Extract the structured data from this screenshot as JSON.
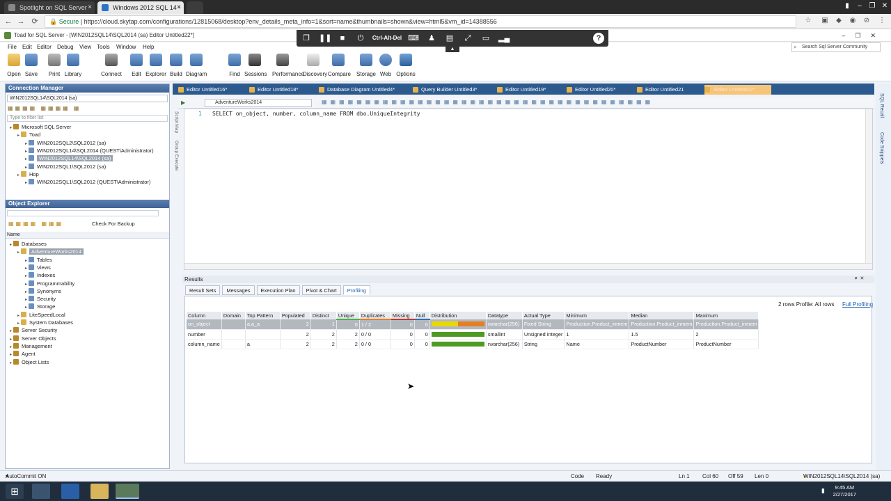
{
  "browser": {
    "tabs": [
      {
        "label": "Spotlight on SQL Server"
      },
      {
        "label": "Windows 2012 SQL 14 -"
      }
    ],
    "url_secure": "Secure",
    "url": "https://cloud.skytap.com/configurations/12815068/desktop?env_details_meta_info=1&sort=name&thumbnails=shown&view=html5&vm_id=14388556"
  },
  "remote_toolbar": {
    "ctrl_alt_del": "Ctrl-Alt-Del",
    "help": "?"
  },
  "toad": {
    "title": "Toad for SQL Server - [WIN2012SQL14\\SQL2014 (sa) Editor Untitled22*]",
    "menu": [
      "File",
      "Edit",
      "Editor",
      "Debug",
      "View",
      "Tools",
      "Window",
      "Help"
    ],
    "search_placeholder": "Search Sql Server Community",
    "ribbon": [
      "Open",
      "Save",
      "Print",
      "Library",
      "Connect",
      "Edit",
      "Explorer",
      "Build",
      "Diagram",
      "Find",
      "Sessions",
      "Performance",
      "Discovery",
      "Compare",
      "Storage",
      "Web",
      "Options"
    ]
  },
  "connection_manager": {
    "title": "Connection Manager",
    "selected_connection": "WIN2012SQL14\\SQL2014 (sa)",
    "filter_placeholder": "Type to filter list",
    "tree": [
      {
        "label": "Microsoft SQL Server",
        "level": 0
      },
      {
        "label": "Toad",
        "level": 1
      },
      {
        "label": "WIN2012SQL2\\SQL2012 (sa)",
        "level": 2
      },
      {
        "label": "WIN2012SQL14\\SQL2014 (QUEST\\Administrator)",
        "level": 2
      },
      {
        "label": "WIN2012SQL14\\SQL2014 (sa)",
        "level": 2,
        "selected": true
      },
      {
        "label": "WIN2012SQL1\\SQL2012 (sa)",
        "level": 2
      },
      {
        "label": "Hop",
        "level": 1
      },
      {
        "label": "WIN2012SQL1\\SQL2012 (QUEST\\Administrator)",
        "level": 2
      }
    ]
  },
  "object_explorer": {
    "title": "Object Explorer",
    "check_backup": "Check For Backup",
    "name_header": "Name",
    "tree": [
      {
        "label": "Databases",
        "level": 0
      },
      {
        "label": "AdventureWorks2014",
        "level": 1,
        "selected": true
      },
      {
        "label": "Tables",
        "level": 2
      },
      {
        "label": "Views",
        "level": 2
      },
      {
        "label": "Indexes",
        "level": 2
      },
      {
        "label": "Programmability",
        "level": 2
      },
      {
        "label": "Synonyms",
        "level": 2
      },
      {
        "label": "Security",
        "level": 2
      },
      {
        "label": "Storage",
        "level": 2
      },
      {
        "label": "LiteSpeedLocal",
        "level": 1
      },
      {
        "label": "System Databases",
        "level": 1
      },
      {
        "label": "Server Security",
        "level": 0
      },
      {
        "label": "Server Objects",
        "level": 0
      },
      {
        "label": "Management",
        "level": 0
      },
      {
        "label": "Agent",
        "level": 0
      },
      {
        "label": "Object Lists",
        "level": 0
      }
    ]
  },
  "editor_tabs": [
    "Editor Untitled16*",
    "Editor Untitled18*",
    "Database Diagram Untitled4*",
    "Query Builder Untitled3*",
    "Editor Untitled19*",
    "Editor Untitled20*",
    "Editor Untitled21",
    "Editor Untitled22*"
  ],
  "editor": {
    "database": "AdventureWorks2014",
    "line_number": "1",
    "sql": "SELECT on_object, number, column_name FROM dbo.UniqueIntegrity",
    "side_labels": [
      "Script Map",
      "Group Execute"
    ]
  },
  "results": {
    "title": "Results",
    "tabs": [
      "Result Sets",
      "Messages",
      "Execution Plan",
      "Pivot & Chart",
      "Profiling"
    ],
    "active_tab": "Profiling",
    "row_info": "2 rows  Profile: All rows",
    "full_profiling": "Full Profiling",
    "columns": [
      "Column",
      "Domain",
      "Top Pattern",
      "Populated",
      "Distinct",
      "Unique",
      "Duplicates",
      "Missing",
      "Null",
      "Distribution",
      "Datatype",
      "Actual Type",
      "Minimum",
      "Median",
      "Maximum"
    ],
    "rows": [
      {
        "Column": "on_object",
        "Domain": "",
        "Top Pattern": "a.a_a",
        "Populated": "2",
        "Distinct": "1",
        "Unique": "0",
        "Duplicates": "1   /   2",
        "Missing": "0",
        "Null": "0",
        "dist": [
          0.5,
          0.5
        ],
        "Datatype": "nvarchar(256)",
        "Actual Type": "Fixed String",
        "Minimum": "Production.Product_inmem",
        "Median": "Production.Product_inmem",
        "Maximum": "Production.Product_inmem"
      },
      {
        "Column": "number",
        "Domain": "",
        "Top Pattern": "",
        "Populated": "2",
        "Distinct": "2",
        "Unique": "2",
        "Duplicates": "0   /   0",
        "Missing": "0",
        "Null": "0",
        "dist": [
          1.0,
          0.0
        ],
        "Datatype": "smallint",
        "Actual Type": "Unsigned Integer",
        "Minimum": "1",
        "Median": "1.5",
        "Maximum": "2"
      },
      {
        "Column": "column_name",
        "Domain": "",
        "Top Pattern": "a",
        "Populated": "2",
        "Distinct": "2",
        "Unique": "2",
        "Duplicates": "0   /   0",
        "Missing": "0",
        "Null": "0",
        "dist": [
          1.0,
          0.0
        ],
        "Datatype": "nvarchar(256)",
        "Actual Type": "String",
        "Minimum": "Name",
        "Median": "ProductNumber",
        "Maximum": "ProductNumber"
      }
    ]
  },
  "status": {
    "autocommit": "AutoCommit ON",
    "mode": "Code",
    "state": "Ready",
    "ln": "Ln 1",
    "col": "Col 60",
    "off": "Off 59",
    "len": "Len 0",
    "connection": "WIN2012SQL14\\SQL2014 (sa)"
  },
  "right_strip": [
    "SQL Recall",
    "Code Snippets"
  ],
  "taskbar": {
    "time": "9:45 AM",
    "date": "2/27/2017"
  }
}
